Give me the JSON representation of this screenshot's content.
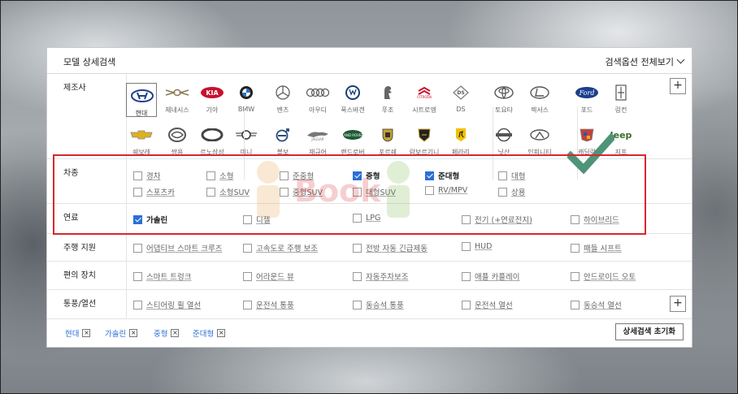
{
  "panel": {
    "title": "모델 상세검색",
    "view_all": "검색옵션 전체보기",
    "reset_label": "상세검색 초기화"
  },
  "labels": {
    "maker": "제조사",
    "car_type": "차종",
    "fuel": "연료",
    "driving": "주행 지원",
    "convenience": "편의 장치",
    "ventilation": "통풍/열선"
  },
  "makers": [
    {
      "name": "현대",
      "icon": "hyundai-logo-icon",
      "selected": true
    },
    {
      "name": "제네시스",
      "icon": "genesis-logo-icon"
    },
    {
      "name": "기아",
      "icon": "kia-logo-icon"
    },
    {
      "name": "쉐보레",
      "icon": "chevrolet-logo-icon"
    },
    {
      "name": "쌍용",
      "icon": "ssangyong-logo-icon"
    },
    {
      "name": "르노삼성",
      "icon": "renault-samsung-logo-icon"
    },
    {
      "name": "BMW",
      "icon": "bmw-logo-icon"
    },
    {
      "name": "벤츠",
      "icon": "mercedes-logo-icon"
    },
    {
      "name": "아우디",
      "icon": "audi-logo-icon"
    },
    {
      "name": "폭스바겐",
      "icon": "volkswagen-logo-icon"
    },
    {
      "name": "푸조",
      "icon": "peugeot-logo-icon"
    },
    {
      "name": "시트로엥",
      "icon": "citroen-logo-icon"
    },
    {
      "name": "DS",
      "icon": "ds-logo-icon"
    },
    {
      "name": "미니",
      "icon": "mini-logo-icon"
    },
    {
      "name": "볼보",
      "icon": "volvo-logo-icon"
    },
    {
      "name": "재규어",
      "icon": "jaguar-logo-icon"
    },
    {
      "name": "랜드로버",
      "icon": "landrover-logo-icon"
    },
    {
      "name": "포르쉐",
      "icon": "porsche-logo-icon"
    },
    {
      "name": "람보르기니",
      "icon": "lamborghini-logo-icon"
    },
    {
      "name": "페라리",
      "icon": "ferrari-logo-icon"
    },
    {
      "name": "토요타",
      "icon": "toyota-logo-icon"
    },
    {
      "name": "렉서스",
      "icon": "lexus-logo-icon"
    },
    {
      "name": "닛산",
      "icon": "nissan-logo-icon"
    },
    {
      "name": "인피니티",
      "icon": "infiniti-logo-icon"
    },
    {
      "name": "포드",
      "icon": "ford-logo-icon"
    },
    {
      "name": "링컨",
      "icon": "lincoln-logo-icon"
    },
    {
      "name": "캐딜락",
      "icon": "cadillac-logo-icon"
    },
    {
      "name": "지프",
      "icon": "jeep-logo-icon"
    }
  ],
  "car_types": [
    {
      "label": "경차",
      "checked": false
    },
    {
      "label": "소형",
      "checked": false
    },
    {
      "label": "준중형",
      "checked": false
    },
    {
      "label": "중형",
      "checked": true
    },
    {
      "label": "준대형",
      "checked": true
    },
    {
      "label": "대형",
      "checked": false
    },
    {
      "label": "스포츠카",
      "checked": false
    },
    {
      "label": "소형SUV",
      "checked": false
    },
    {
      "label": "중형SUV",
      "checked": false
    },
    {
      "label": "대형SUV",
      "checked": false
    },
    {
      "label": "RV/MPV",
      "checked": false
    },
    {
      "label": "상용",
      "checked": false
    }
  ],
  "fuels": [
    {
      "label": "가솔린",
      "checked": true
    },
    {
      "label": "디젤",
      "checked": false
    },
    {
      "label": "LPG",
      "checked": false
    },
    {
      "label": "전기 (+연료전지)",
      "checked": false
    },
    {
      "label": "하이브리드",
      "checked": false
    }
  ],
  "driving": [
    "어댑티브 스마트 크루즈",
    "고속도로 주행 보조",
    "전방 자동 긴급제동",
    "HUD",
    "패들 시프트"
  ],
  "convenience": [
    "스마트 트렁크",
    "어라운드 뷰",
    "자동주차보조",
    "애플 카플레이",
    "안드로이드 오토"
  ],
  "ventilation": [
    "스티어링 휠 열선",
    "운전석 통풍",
    "동승석 통풍",
    "운전석 열선",
    "동승석 열선"
  ],
  "selected_tags": [
    "현대",
    "가솔린",
    "중형",
    "준대형"
  ],
  "watermark_text": "Book",
  "colors": {
    "accent": "#2b6fd6",
    "highlight": "#d9272e",
    "check": "#4f9478"
  }
}
